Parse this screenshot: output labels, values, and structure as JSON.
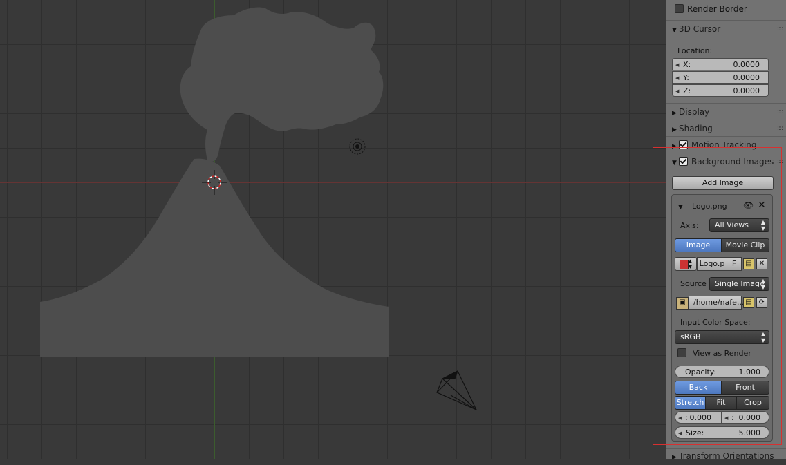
{
  "panel": {
    "render_border": {
      "label": "Render Border",
      "checked": false
    },
    "cursor": {
      "title": "3D Cursor",
      "location_label": "Location:",
      "x": {
        "label": "X:",
        "value": "0.0000"
      },
      "y": {
        "label": "Y:",
        "value": "0.0000"
      },
      "z": {
        "label": "Z:",
        "value": "0.0000"
      }
    },
    "display": {
      "title": "Display"
    },
    "shading": {
      "title": "Shading"
    },
    "motion_tracking": {
      "title": "Motion Tracking",
      "checked": true
    },
    "background_images": {
      "title": "Background Images",
      "checked": true,
      "add_image_label": "Add Image",
      "image": {
        "name": "Logo.png",
        "axis_label": "Axis:",
        "axis_value": "All Views",
        "source_tabs": [
          "Image",
          "Movie Clip"
        ],
        "selected_source_tab": "Image",
        "datablock_name": "Logo.p",
        "fake_user_label": "F",
        "source_label": "Source",
        "source_value": "Single Image",
        "filepath": "/home/nafe...",
        "color_space_label": "Input Color Space:",
        "color_space_value": "sRGB",
        "view_as_render": {
          "label": "View as Render",
          "checked": false
        },
        "opacity": {
          "label": "Opacity:",
          "value": "1.000"
        },
        "depth_tabs": [
          "Back",
          "Front"
        ],
        "selected_depth": "Back",
        "frame_tabs": [
          "Stretch",
          "Fit",
          "Crop"
        ],
        "selected_frame": "Stretch",
        "offset_x": {
          "label": ":",
          "value": "0.000"
        },
        "offset_y": {
          "label": ":",
          "value": "0.000"
        },
        "size": {
          "label": "Size:",
          "value": "5.000"
        }
      }
    },
    "transform_orientations": {
      "title": "Transform Orientations"
    }
  },
  "colors": {
    "selection_blue": "#5680c2",
    "highlight_red": "#d83030",
    "viewport_bg": "#393939"
  }
}
